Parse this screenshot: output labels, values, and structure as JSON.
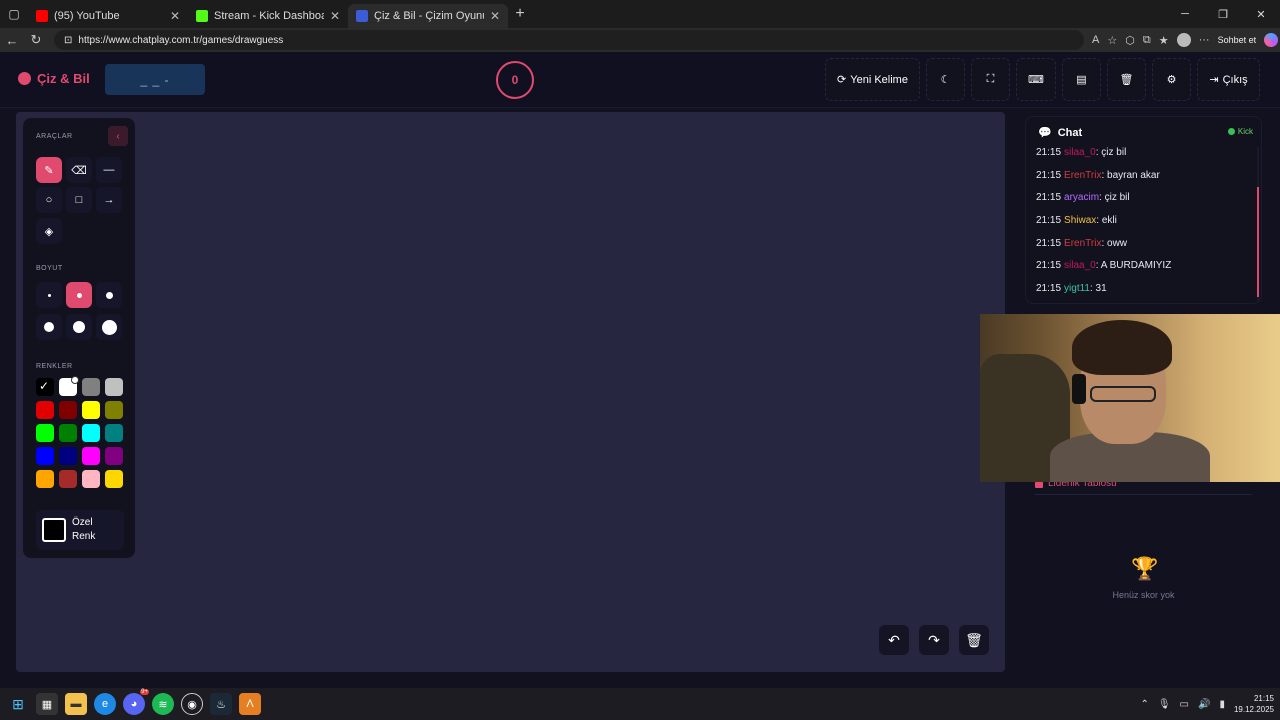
{
  "browser": {
    "tabs": [
      {
        "title": "(95) YouTube",
        "color": "#ff0000",
        "active": false
      },
      {
        "title": "Stream - Kick Dashboard",
        "color": "#53fc18",
        "active": false
      },
      {
        "title": "Çiz & Bil - Çizim Oyunu",
        "color": "#3b5bdb",
        "active": true
      }
    ],
    "url": "https://www.chatplay.com.tr/games/drawguess",
    "sohbet_label": "Sohbet et"
  },
  "header": {
    "logo": "Çiz & Bil",
    "word_hint": "_ _ -",
    "timer": "0",
    "new_word": "Yeni Kelime",
    "exit": "Çıkış"
  },
  "tools": {
    "tools_label": "ARAÇLAR",
    "size_label": "BOYUT",
    "colors_label": "RENKLER",
    "custom_label": "Özel Renk",
    "colors": [
      "#000000",
      "#ffffff",
      "#808080",
      "#c0c0c0",
      "#e00000",
      "#800000",
      "#ffff00",
      "#808000",
      "#00ff00",
      "#008000",
      "#00ffff",
      "#008080",
      "#0000ff",
      "#000080",
      "#ff00ff",
      "#800080",
      "#ffa500",
      "#a52a2a",
      "#ffb6c1",
      "#ffd700"
    ]
  },
  "chat": {
    "title": "Chat",
    "platform": "Kick",
    "messages": [
      {
        "time": "21:15",
        "user": "silaa_0",
        "color": "#c2185b",
        "text": ": çiz bil"
      },
      {
        "time": "21:15",
        "user": "ErenTrix",
        "color": "#d23b3b",
        "text": ": bayran akar"
      },
      {
        "time": "21:15",
        "user": "aryacim",
        "color": "#b56cff",
        "text": ": çiz bil"
      },
      {
        "time": "21:15",
        "user": "Shiwax",
        "color": "#f0c040",
        "text": ": ekli"
      },
      {
        "time": "21:15",
        "user": "ErenTrix",
        "color": "#d23b3b",
        "text": ": oww"
      },
      {
        "time": "21:15",
        "user": "silaa_0",
        "color": "#c2185b",
        "text": ": A BURDAMIYIZ"
      },
      {
        "time": "21:15",
        "user": "yigt11",
        "color": "#39c2a6",
        "text": ": 31"
      }
    ]
  },
  "leaderboard": {
    "title": "Liderlik Tablosu",
    "empty": "Henüz skor yok"
  },
  "taskbar": {
    "time": "21:15",
    "date": "19.12.2025",
    "discord_badge": "9+"
  }
}
